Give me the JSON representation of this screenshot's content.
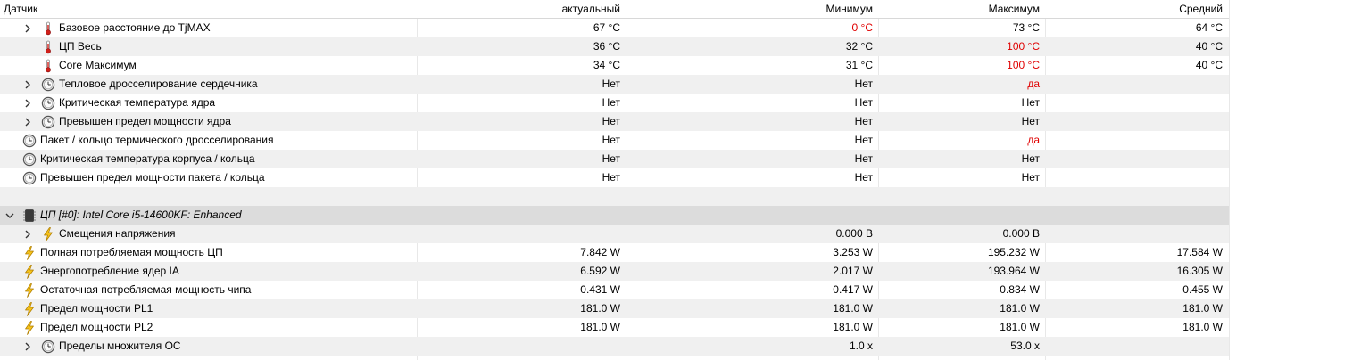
{
  "columns": {
    "sensor": "Датчик",
    "current": "актуальный",
    "min": "Минимум",
    "max": "Максимум",
    "avg": "Средний"
  },
  "colors": {
    "alert": "#e00000",
    "row_alt": "#f0f0f0",
    "group_row": "#dcdcdc"
  },
  "rows": [
    {
      "label": "Базовое расстояние до TjMAX",
      "icon": "thermometer-icon",
      "expander": "collapsed",
      "indent": 1,
      "current": "67 °C",
      "min": "0 °C",
      "max": "73 °C",
      "avg": "64 °C",
      "red": [
        "min"
      ]
    },
    {
      "label": "ЦП Весь",
      "icon": "thermometer-icon",
      "expander": "none",
      "indent": 1,
      "current": "36 °C",
      "min": "32 °C",
      "max": "100 °C",
      "avg": "40 °C",
      "red": [
        "max"
      ]
    },
    {
      "label": "Core Максимум",
      "icon": "thermometer-icon",
      "expander": "none",
      "indent": 1,
      "current": "34 °C",
      "min": "31 °C",
      "max": "100 °C",
      "avg": "40 °C",
      "red": [
        "max"
      ]
    },
    {
      "label": "Тепловое дросселирование сердечника",
      "icon": "clock-icon",
      "expander": "collapsed",
      "indent": 1,
      "current": "Нет",
      "min": "Нет",
      "max": "да",
      "avg": "",
      "red": [
        "max"
      ]
    },
    {
      "label": "Критическая температура ядра",
      "icon": "clock-icon",
      "expander": "collapsed",
      "indent": 1,
      "current": "Нет",
      "min": "Нет",
      "max": "Нет",
      "avg": "",
      "red": []
    },
    {
      "label": "Превышен предел мощности ядра",
      "icon": "clock-icon",
      "expander": "collapsed",
      "indent": 1,
      "current": "Нет",
      "min": "Нет",
      "max": "Нет",
      "avg": "",
      "red": []
    },
    {
      "label": "Пакет / кольцо термического дросселирования",
      "icon": "clock-icon",
      "expander": "none",
      "indent": 0,
      "current": "Нет",
      "min": "Нет",
      "max": "да",
      "avg": "",
      "red": [
        "max"
      ]
    },
    {
      "label": "Критическая температура корпуса / кольца",
      "icon": "clock-icon",
      "expander": "none",
      "indent": 0,
      "current": "Нет",
      "min": "Нет",
      "max": "Нет",
      "avg": "",
      "red": []
    },
    {
      "label": "Превышен предел мощности пакета / кольца",
      "icon": "clock-icon",
      "expander": "none",
      "indent": 0,
      "current": "Нет",
      "min": "Нет",
      "max": "Нет",
      "avg": "",
      "red": []
    },
    {
      "label": "",
      "icon": "",
      "expander": "none",
      "indent": 0,
      "current": "",
      "min": "",
      "max": "",
      "avg": "",
      "red": [],
      "blank": true
    },
    {
      "label": "ЦП [#0]: Intel Core i5-14600KF: Enhanced",
      "icon": "cpu-chip-icon",
      "expander": "expanded",
      "indent": 0,
      "current": "",
      "min": "",
      "max": "",
      "avg": "",
      "red": [],
      "group": true
    },
    {
      "label": "Смещения напряжения",
      "icon": "lightning-icon",
      "expander": "collapsed",
      "indent": 1,
      "current": "",
      "min": "0.000 В",
      "max": "0.000 В",
      "avg": "",
      "red": []
    },
    {
      "label": "Полная потребляемая мощность ЦП",
      "icon": "lightning-icon",
      "expander": "none",
      "indent": 0,
      "current": "7.842 W",
      "min": "3.253 W",
      "max": "195.232 W",
      "avg": "17.584 W",
      "red": []
    },
    {
      "label": "Энергопотребление ядер IA",
      "icon": "lightning-icon",
      "expander": "none",
      "indent": 0,
      "current": "6.592 W",
      "min": "2.017 W",
      "max": "193.964 W",
      "avg": "16.305 W",
      "red": []
    },
    {
      "label": "Остаточная потребляемая мощность чипа",
      "icon": "lightning-icon",
      "expander": "none",
      "indent": 0,
      "current": "0.431 W",
      "min": "0.417 W",
      "max": "0.834 W",
      "avg": "0.455 W",
      "red": []
    },
    {
      "label": "Предел мощности PL1",
      "icon": "lightning-icon",
      "expander": "none",
      "indent": 0,
      "current": "181.0 W",
      "min": "181.0 W",
      "max": "181.0 W",
      "avg": "181.0 W",
      "red": []
    },
    {
      "label": "Предел мощности PL2",
      "icon": "lightning-icon",
      "expander": "none",
      "indent": 0,
      "current": "181.0 W",
      "min": "181.0 W",
      "max": "181.0 W",
      "avg": "181.0 W",
      "red": []
    },
    {
      "label": "Пределы множителя OC",
      "icon": "clock-icon",
      "expander": "collapsed",
      "indent": 1,
      "current": "",
      "min": "1.0 x",
      "max": "53.0 x",
      "avg": "",
      "red": []
    }
  ]
}
